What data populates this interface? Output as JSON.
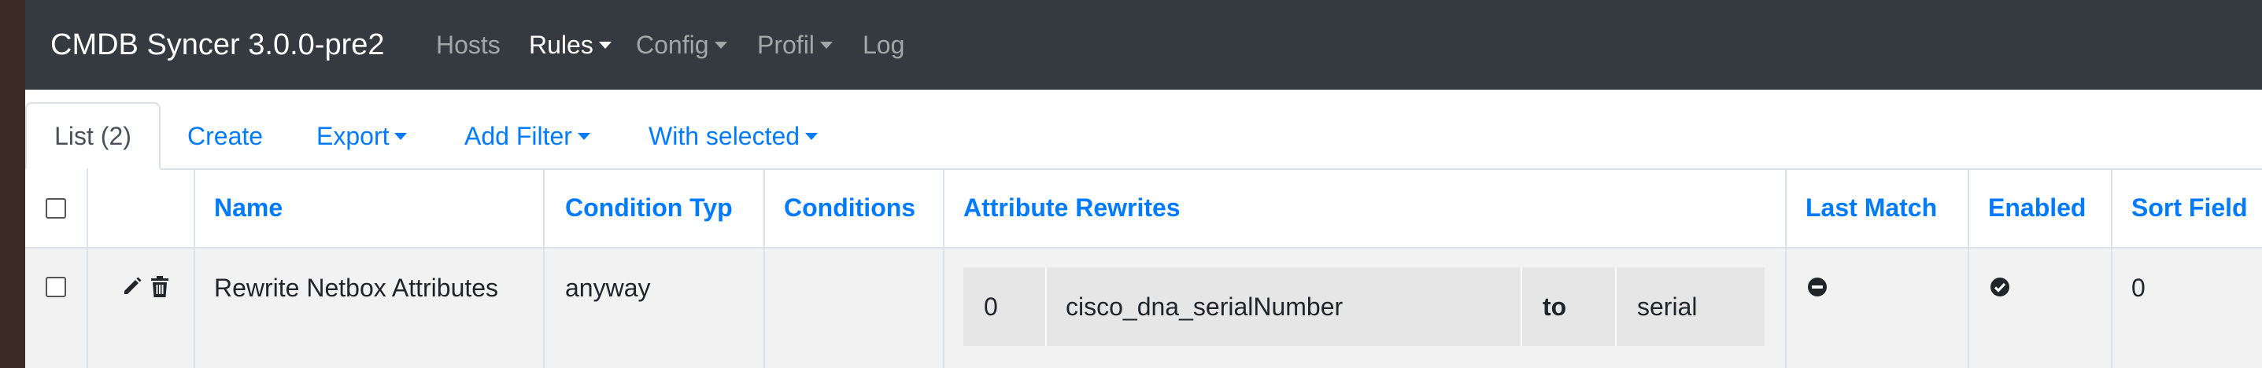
{
  "navbar": {
    "brand": "CMDB Syncer 3.0.0-pre2",
    "items": [
      {
        "label": "Hosts"
      },
      {
        "label": "Rules"
      },
      {
        "label": "Config"
      },
      {
        "label": "Profil"
      },
      {
        "label": "Log"
      }
    ]
  },
  "tabs": [
    {
      "label": "List (2)"
    },
    {
      "label": "Create"
    },
    {
      "label": "Export"
    },
    {
      "label": "Add Filter"
    },
    {
      "label": "With selected"
    }
  ],
  "table": {
    "columns": [
      "Name",
      "Condition Typ",
      "Conditions",
      "Attribute Rewrites",
      "Last Match",
      "Enabled",
      "Sort Field"
    ],
    "rows": [
      {
        "name": "Rewrite Netbox Attributes",
        "condition_typ": "anyway",
        "conditions": "",
        "rewrite": {
          "index": "0",
          "from": "cisco_dna_serialNumber",
          "to_label": "to",
          "to": "serial"
        },
        "last_match": "no",
        "enabled": "yes",
        "sort_field": "0"
      }
    ]
  },
  "icons": {
    "edit": "pencil-icon",
    "delete": "trash-icon",
    "last_match": "minus-circle-icon",
    "enabled": "check-circle-icon"
  },
  "colors": {
    "navbar_bg": "#343a40",
    "link": "#007bff",
    "row_bg": "#f2f2f2",
    "rewrite_bg": "#e6e6e6"
  }
}
